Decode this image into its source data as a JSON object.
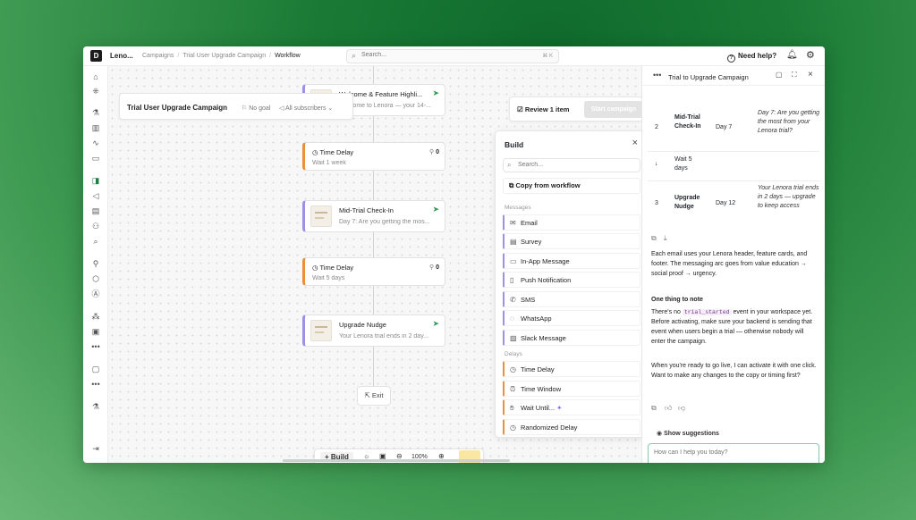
{
  "topbar": {
    "logo": "D",
    "org": "Leno...",
    "breadcrumbs": [
      "Campaigns",
      "Trial User Upgrade Campaign",
      "Workflow"
    ],
    "search_placeholder": "Search...",
    "search_shortcut": "⌘ K",
    "help": "Need help?"
  },
  "canvas": {
    "campaign_title": "Trial User Upgrade Campaign",
    "goal": "No goal",
    "audience": "All subscribers",
    "review_button": "Review 1 item",
    "start_button": "Start campaign",
    "nodes": [
      {
        "type": "email",
        "title": "Welcome & Feature Highli...",
        "subtitle": "Welcome to Lenora — your 14-..."
      },
      {
        "type": "delay",
        "title": "Time Delay",
        "subtitle": "Wait 1 week",
        "count": "0"
      },
      {
        "type": "email",
        "title": "Mid-Trial Check-In",
        "subtitle": "Day 7: Are you getting the mos..."
      },
      {
        "type": "delay",
        "title": "Time Delay",
        "subtitle": "Wait 5 days",
        "count": "0"
      },
      {
        "type": "email",
        "title": "Upgrade Nudge",
        "subtitle": "Your Lenora trial ends in 2 day..."
      }
    ],
    "exit_label": "Exit",
    "toolbar": {
      "build": "Build",
      "zoom": "100%"
    }
  },
  "build_panel": {
    "title": "Build",
    "search_placeholder": "Search...",
    "copy_from_workflow": "Copy from workflow",
    "messages_label": "Messages",
    "messages": [
      "Email",
      "Survey",
      "In-App Message",
      "Push Notification",
      "SMS",
      "WhatsApp",
      "Slack Message"
    ],
    "delays_label": "Delays",
    "delays": [
      "Time Delay",
      "Time Window",
      "Wait Until...",
      "Randomized Delay"
    ]
  },
  "chat": {
    "title": "Trial to Upgrade Campaign",
    "table_rows": [
      {
        "num": "2",
        "name": "Mid-Trial Check-In",
        "day": "Day 7",
        "desc": "Day 7: Are you getting the most from your Lenora trial?"
      },
      {
        "num": "↓",
        "name": "Wait 5 days",
        "day": "",
        "desc": ""
      },
      {
        "num": "3",
        "name": "Upgrade Nudge",
        "day": "Day 12",
        "desc": "Your Lenora trial ends in 2 days — upgrade to keep access"
      }
    ],
    "para1": "Each email uses your Lenora header, feature cards, and footer. The messaging arc goes from value education → social proof → urgency.",
    "note_heading": "One thing to note",
    "note_pre": "There's no ",
    "note_code": "trial_started",
    "note_post": " event in your workspace yet. Before activating, make sure your backend is sending that event when users begin a trial — otherwise nobody will enter the campaign.",
    "para3": "When you're ready to go live, I can activate it with one click. Want to make any changes to the copy or timing first?",
    "show_suggestions": "Show suggestions",
    "input_placeholder": "How can I help you today?"
  }
}
